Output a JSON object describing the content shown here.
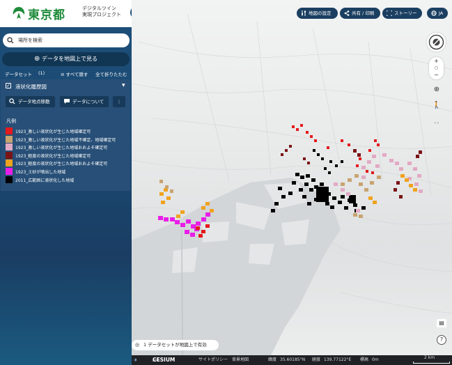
{
  "brand": {
    "logo_text": "東京都",
    "subtitle_line1": "デジタルツイン",
    "subtitle_line2": "実現プロジェクト",
    "emblem_color": "#1f8b3a"
  },
  "sidebar": {
    "close_icon": "close-icon",
    "search_placeholder": "場所を検索",
    "add_data_label": "データを地図上で見る",
    "dataset_label": "データセット",
    "dataset_count": "(1)",
    "hide_all_label": "すべて隠す",
    "collapse_all_label": "全て折りたたむ",
    "layer": {
      "title": "液状化履歴図",
      "checked": true,
      "zoom_button": "データ地点移動",
      "about_button": "データについて",
      "legend_title": "凡例",
      "legend": [
        {
          "color": "#e41a1c",
          "label": "1923_激しい液状化が生じた地域確定可"
        },
        {
          "color": "#c8a470",
          "label": "1923_激しい液状化が生じた地域不確定、地域確定可"
        },
        {
          "color": "#e2a9c4",
          "label": "1923_激しい液状化が生じた地域おおよそ確定可"
        },
        {
          "color": "#7a1416",
          "label": "1923_軽度の液状化が生じた地域確定可"
        },
        {
          "color": "#f0a21e",
          "label": "1923_軽度の液状化が生じた地域おおよそ確定可"
        },
        {
          "color": "#e81ee8",
          "label": "1923_土砂が噴出した地域"
        },
        {
          "color": "#000000",
          "label": "2011_広範囲に液状化した地域"
        }
      ]
    }
  },
  "topbar": {
    "map_settings": "地図の設定",
    "share": "共有 / 印刷",
    "story": "ストーリー",
    "language": "JA"
  },
  "map": {
    "status_message": "1 データセットが地図上で有効",
    "footer": {
      "cesium": "CESIUM",
      "ion": "ion",
      "site_policy": "サイトポリシー",
      "background": "背景地図",
      "lat_label": "緯度",
      "lat_value": "35.60185°N",
      "lon_label": "経度",
      "lon_value": "139.77122°E",
      "elev_label": "標高",
      "elev_value": "0m",
      "scale": "2 km"
    }
  }
}
